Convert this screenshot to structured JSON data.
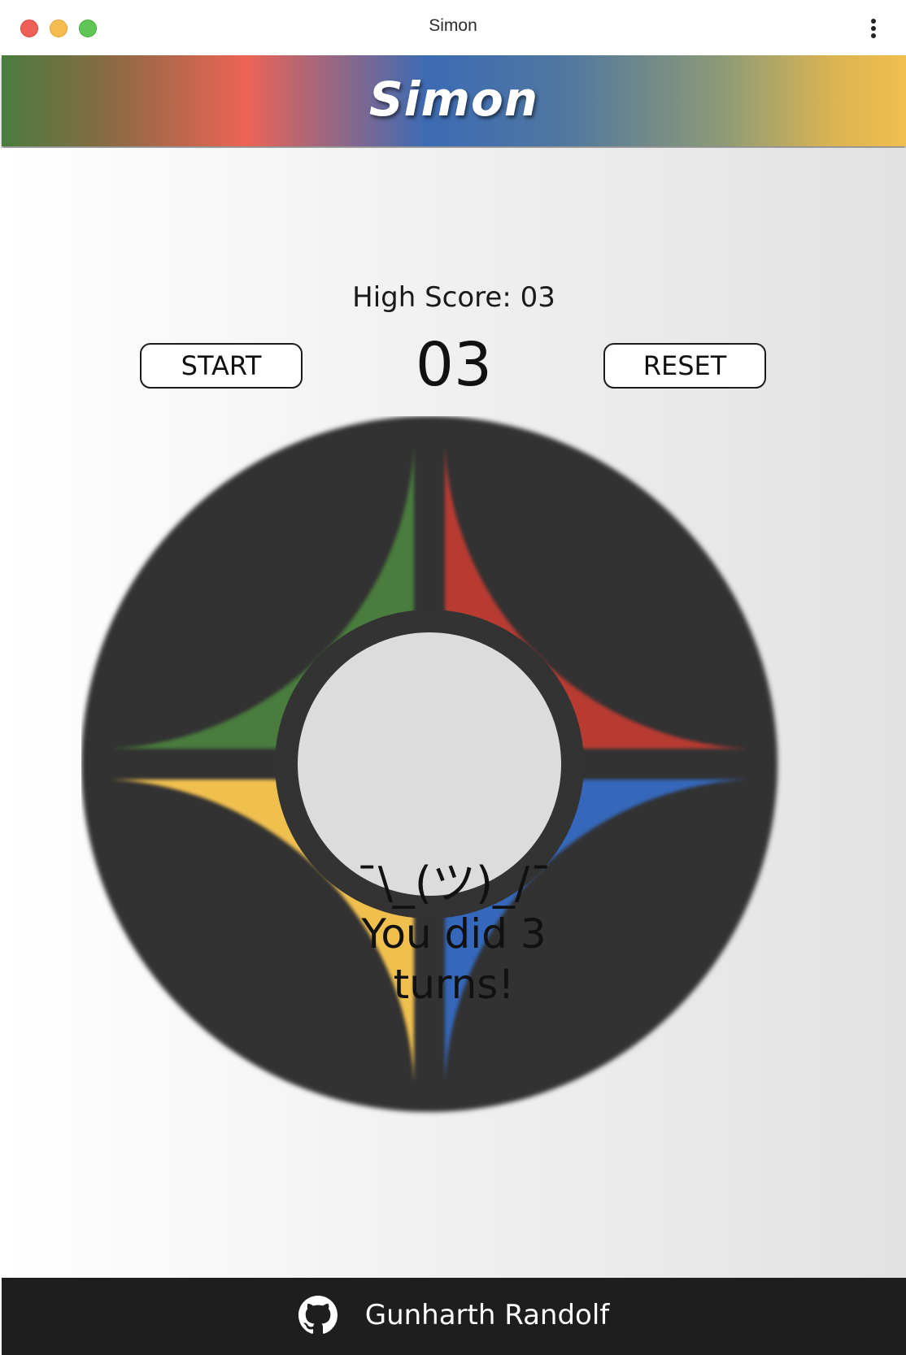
{
  "window": {
    "title": "Simon"
  },
  "header": {
    "title": "Simon"
  },
  "game": {
    "high_score_label": "High Score: 03",
    "count": "03",
    "start_label": "START",
    "reset_label": "RESET",
    "center_shrug": "¯\\_(ツ)_/¯",
    "center_message_line1": "You did 3",
    "center_message_line2": "turns!",
    "pads": [
      {
        "name": "green",
        "color": "#4a7c3d"
      },
      {
        "name": "red",
        "color": "#b83a33"
      },
      {
        "name": "yellow",
        "color": "#f0c04f"
      },
      {
        "name": "blue",
        "color": "#3467ba"
      }
    ],
    "frame_color": "#333333",
    "center_color": "#dcdcdc"
  },
  "footer": {
    "author": "Gunharth Randolf",
    "icon": "github-icon"
  }
}
